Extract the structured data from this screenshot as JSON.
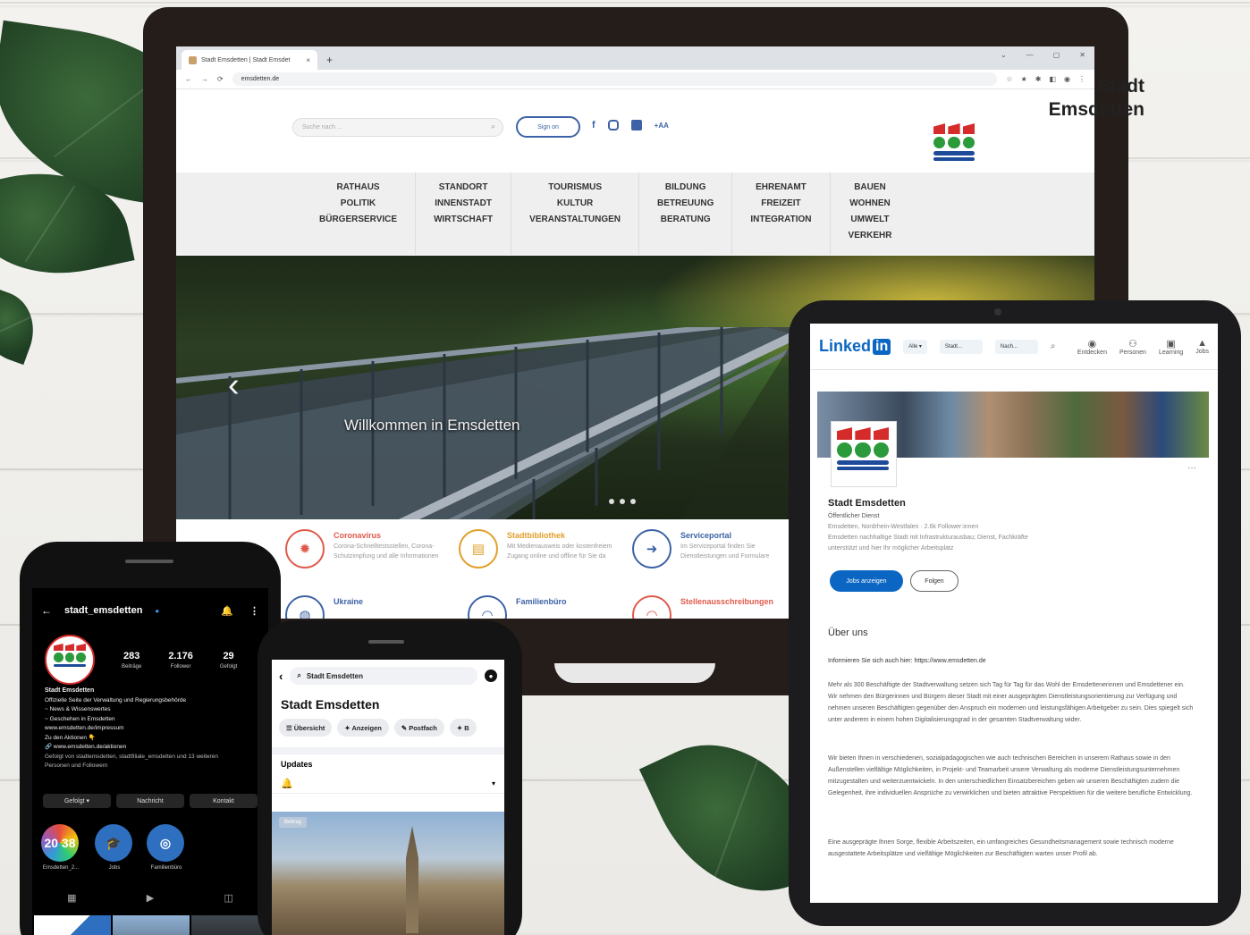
{
  "colors": {
    "brand_blue": "#3d63a6",
    "brand_red": "#d52b2b",
    "brand_green": "#2a9a3b",
    "linkedin_blue": "#0a66c2",
    "tile_red": "#e05a4b",
    "tile_orange": "#e0a02a",
    "tile_blue": "#3d63a6"
  },
  "monitor": {
    "browser": {
      "tab_title": "Stadt Emsdetten | Stadt Emsdet",
      "tab_close": "×",
      "new_tab": "+",
      "url": "emsdetten.de",
      "window_controls": [
        "⌄",
        "—",
        "▢",
        "✕"
      ],
      "nav_icons": [
        "←",
        "→",
        "⟳"
      ],
      "extension_icons": [
        "☆",
        "★",
        "✱",
        "◧",
        "◉",
        "⋮"
      ]
    },
    "site": {
      "search_placeholder": "Suche nach ...",
      "signin_label": "Sign on",
      "lang_label": "+AA",
      "brand_line1": "Stadt",
      "brand_line2": "Emsdetten",
      "nav": [
        [
          "RATHAUS",
          "POLITIK",
          "BÜRGERSERVICE"
        ],
        [
          "STANDORT",
          "INNENSTADT",
          "WIRTSCHAFT"
        ],
        [
          "TOURISMUS",
          "KULTUR",
          "VERANSTALTUNGEN"
        ],
        [
          "BILDUNG",
          "BETREUUNG",
          "BERATUNG"
        ],
        [
          "EHRENAMT",
          "FREIZEIT",
          "INTEGRATION"
        ],
        [
          "BAUEN",
          "WOHNEN",
          "UMWELT",
          "VERKEHR"
        ]
      ],
      "hero_title": "Willkommen in Emsdetten",
      "hero_prev": "‹",
      "tiles": [
        {
          "title": "Coronavirus",
          "desc": "Corona-Schnelltestsstellen, Corona-Schutzimpfung und alle Informationen",
          "icon": "✹"
        },
        {
          "title": "Stadtbibliothek",
          "desc": "Mit Medienausweis oder kostenfreiem Zugang online und offline für Sie da",
          "icon": "▤"
        },
        {
          "title": "Serviceportal",
          "desc": "Im Serviceportal finden Sie Dienstleistungen und Formulare",
          "icon": "➜"
        },
        {
          "title": "Ukraine",
          "desc": "",
          "icon": "◍"
        },
        {
          "title": "Familienbüro",
          "desc": "",
          "icon": "◠"
        },
        {
          "title": "Stellenausschreibungen",
          "desc": "",
          "icon": "◠"
        }
      ]
    }
  },
  "tablet": {
    "linkedin": {
      "logo_text": "Linked",
      "logo_in": "in",
      "fields": [
        "Alle ▾",
        "Stadt...",
        "Nach...",
        "⌕"
      ],
      "nav": [
        {
          "icon": "◉",
          "label": "Entdecken"
        },
        {
          "icon": "⚇",
          "label": "Personen"
        },
        {
          "icon": "▣",
          "label": "Learning"
        },
        {
          "icon": "▲",
          "label": "Jobs"
        }
      ],
      "company_name": "Stadt Emsdetten",
      "company_type": "Öffentlicher Dienst",
      "company_meta": "Emsdetten, Nordrhein-Westfalen · 2.6k Follower:innen",
      "company_blurb": "Emsdetten nachhaltige Stadt mit Infrastrukturausbau; Dienst, Fachkräfte unterstützt und hier Ihr möglicher Arbeitsplatz",
      "btn_jobs": "Jobs anzeigen",
      "btn_follow": "Folgen",
      "more": "···",
      "about_heading": "Über uns",
      "about_url": "Informieren Sie sich auch hier: https://www.emsdetten.de",
      "paragraphs": [
        "Mehr als 300 Beschäftigte der Stadtverwaltung setzen sich Tag für Tag für das Wohl der Emsdettenerinnen und Emsdettener ein. Wir nehmen den Bürgerinnen und Bürgern dieser Stadt mit einer ausgeprägten Dienstleistungsorientierung zur Verfügung und nehmen unseren Beschäftigten gegenüber den Anspruch ein modernen und leistungsfähigen Arbeitgeber zu sein. Dies spiegelt sich unter anderem in einem hohen Digitalisierungsgrad in der gesamten Stadtverwaltung wider.",
        "Wir bieten Ihnen in verschiedenen, sozialpädagogischen wie auch technischen Bereichen in unserem Rathaus sowie in den Außenstellen vielfältige Möglichkeiten, in Projekt- und Teamarbeit unsere Verwaltung als moderne Dienstleistungsunternehmen mitzugestalten und weiterzuentwickeln. In den unterschiedlichen Einsatzbereichen geben wir unseren Beschäftigten zudem die Gelegenheit, ihre individuellen Ansprüche zu verwirklichen und bieten attraktive Perspektiven für die weitere berufliche Entwicklung.",
        "Eine ausgeprägte Ihnen Sorge, flexible Arbeitszeiten, ein umfangreiches Gesundheitsmanagement sowie technisch moderne ausgestattete Arbeitsplätze und vielfältige Möglichkeiten zur Beschäftigten warten unser Profil ab."
      ]
    }
  },
  "phone_instagram": {
    "back": "←",
    "username": "stadt_emsdetten",
    "verified": "●",
    "bell": "🔔",
    "menu": "⋮",
    "stats": [
      {
        "value": "283",
        "label": "Beiträge"
      },
      {
        "value": "2.176",
        "label": "Follower"
      },
      {
        "value": "29",
        "label": "Gefolgt"
      }
    ],
    "bio_name": "Stadt Emsdetten",
    "bio_lines": [
      "Offizielle Seite der Verwaltung und Regierungsbehörde",
      "~ News & Wissenswertes",
      "~ Geschehen in Emsdetten",
      "www.emsdetten.de/impressum",
      "Zu den Aktionen 👇",
      "🔗 www.emsdetten.de/aktionen",
      "Gefolgt von stadtemsdetten, stadtfiliale_emsdetten und 13 weiteren Personen und Followern"
    ],
    "buttons": [
      "Gefolgt ▾",
      "Nachricht",
      "Kontakt"
    ],
    "highlights": [
      {
        "label": "Emsdetten_2...",
        "text": "20 38"
      },
      {
        "label": "Jobs",
        "text": "🎓"
      },
      {
        "label": "Familienbüro",
        "text": "◎"
      }
    ],
    "grid_tabs": [
      "▦",
      "▶",
      "◫"
    ]
  },
  "phone_facebook": {
    "back": "‹",
    "search_text": "Stadt Emsdetten",
    "page_title": "Stadt Emsdetten",
    "chips": [
      "☰ Übersicht",
      "✦ Anzeigen",
      "✎ Postfach",
      "✦ B"
    ],
    "updates": "Updates",
    "badge": "Beitrag",
    "bell": "🔔",
    "chevron": "▾"
  }
}
